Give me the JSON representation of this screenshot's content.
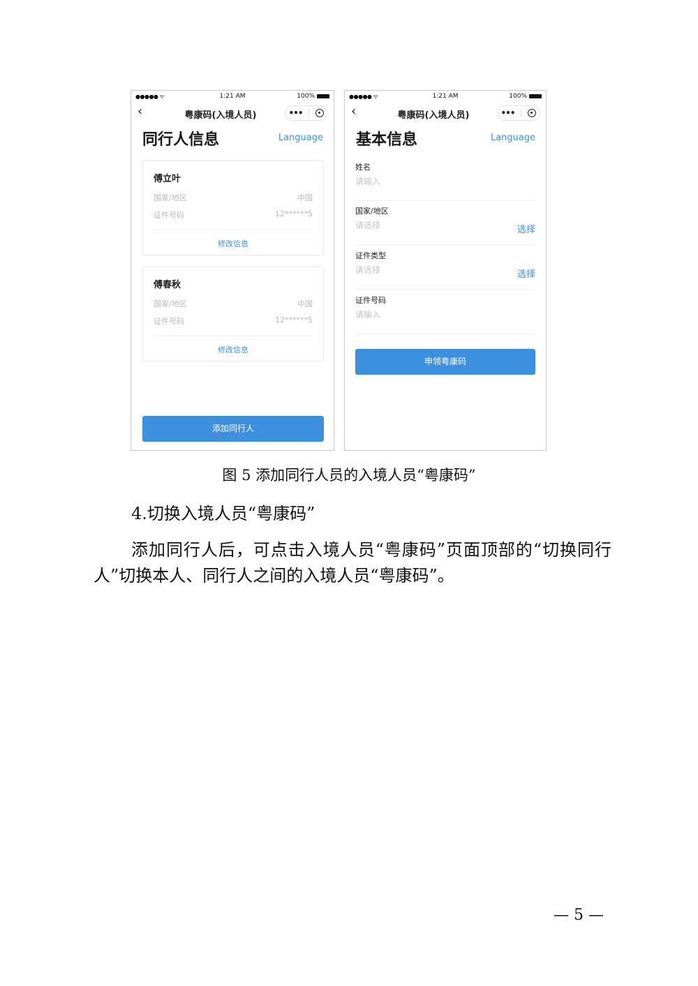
{
  "status_bar": {
    "signal": "●●●●● ᯤ",
    "time": "1:21 AM",
    "battery": "100%"
  },
  "mini_program": {
    "title": "粤康码(入境人员)",
    "more_icon": "•••"
  },
  "screen_left": {
    "heading": "同行人信息",
    "language": "Language",
    "companions": [
      {
        "name": "傅立叶",
        "country_label": "国家/地区",
        "country_value": "中国",
        "id_label": "证件号码",
        "id_value": "12******5",
        "edit_label": "修改信息"
      },
      {
        "name": "傅春秋",
        "country_label": "国家/地区",
        "country_value": "中国",
        "id_label": "证件号码",
        "id_value": "12******5",
        "edit_label": "修改信息"
      }
    ],
    "add_button": "添加同行人"
  },
  "screen_right": {
    "heading": "基本信息",
    "language": "Language",
    "fields": [
      {
        "label": "姓名",
        "placeholder": "请输入",
        "action": ""
      },
      {
        "label": "国家/地区",
        "placeholder": "请选择",
        "action": "选择"
      },
      {
        "label": "证件类型",
        "placeholder": "请选择",
        "action": "选择"
      },
      {
        "label": "证件号码",
        "placeholder": "请输入",
        "action": ""
      }
    ],
    "apply_button": "申领粤康码"
  },
  "document": {
    "caption": "图 5 添加同行人员的入境人员“粤康码”",
    "section_heading": "4.切换入境人员“粤康码”",
    "paragraph": "添加同行人后，可点击入境人员“粤康码”页面顶部的“切换同行人”切换本人、同行人之间的入境人员“粤康码”。",
    "page_number": "— 5 —"
  }
}
